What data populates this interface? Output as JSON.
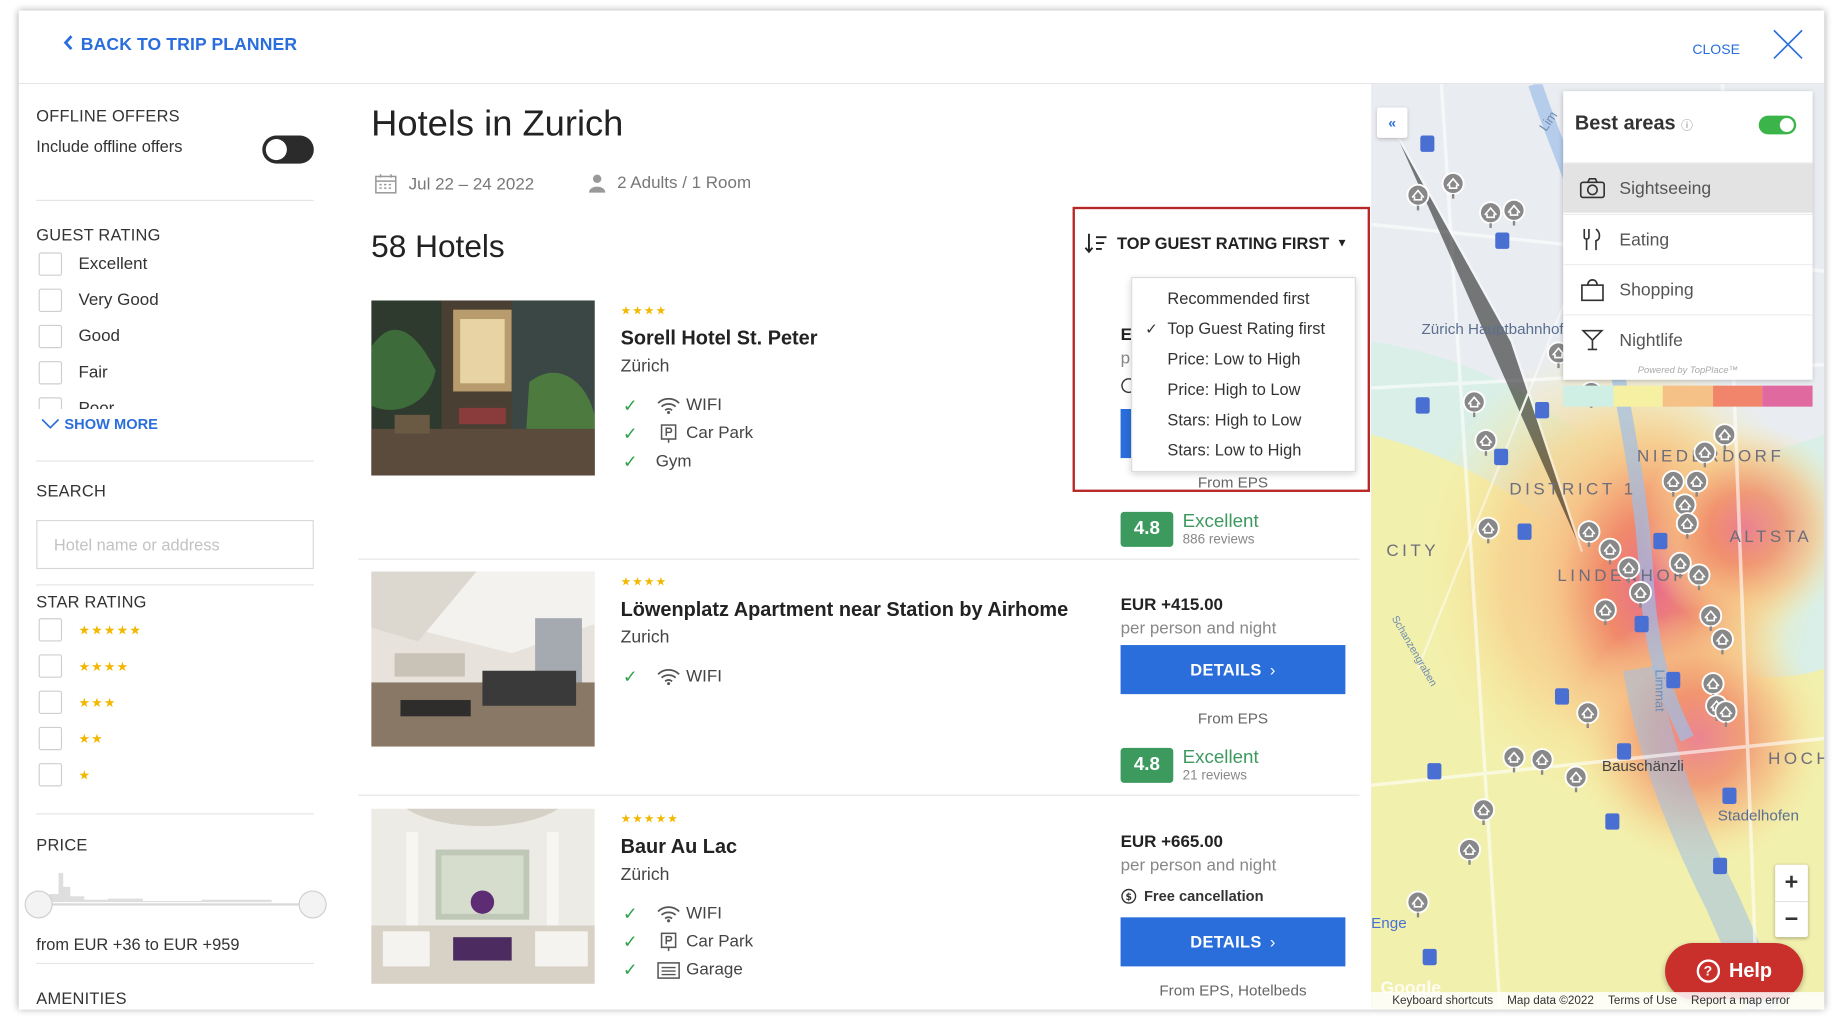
{
  "header": {
    "back_label": "BACK TO TRIP PLANNER",
    "close_label": "CLOSE"
  },
  "sidebar": {
    "offline": {
      "title": "OFFLINE OFFERS",
      "toggle_label": "Include offline offers",
      "enabled": false
    },
    "guest_rating": {
      "title": "GUEST RATING",
      "options": [
        "Excellent",
        "Very Good",
        "Good",
        "Fair",
        "Poor"
      ],
      "show_more": "SHOW MORE"
    },
    "search": {
      "title": "SEARCH",
      "placeholder": "Hotel name or address"
    },
    "star_rating": {
      "title": "STAR RATING",
      "options": [
        "★★★★★",
        "★★★★",
        "★★★",
        "★★",
        "★"
      ]
    },
    "price": {
      "title": "PRICE",
      "range_text": "from EUR +36 to EUR +959"
    },
    "amenities": {
      "title": "AMENITIES"
    }
  },
  "main": {
    "title": "Hotels in Zurich",
    "dates": "Jul 22 – 24 2022",
    "guests": "2 Adults / 1 Room",
    "count": "58 Hotels",
    "sort": {
      "label": "TOP GUEST RATING FIRST",
      "options": [
        "Recommended first",
        "Top Guest Rating first",
        "Price: Low to High",
        "Price: High to Low",
        "Stars: High to Low",
        "Stars: Low to High"
      ],
      "selected": "Top Guest Rating first"
    },
    "hotels": [
      {
        "stars": "★★★★",
        "name": "Sorell Hotel St. Peter",
        "city": "Zürich",
        "amenities": [
          "WIFI",
          "Car Park",
          "Gym"
        ],
        "price_partial": "E",
        "price_per_partial": "p",
        "source": "From EPS",
        "rating": "4.8",
        "rating_word": "Excellent",
        "reviews": "886 reviews"
      },
      {
        "stars": "★★★★",
        "name": "Löwenplatz Apartment near Station by Airhome",
        "city": "Zurich",
        "amenities": [
          "WIFI"
        ],
        "price": "EUR +415.00",
        "price_per": "per person and night",
        "details_label": "DETAILS",
        "source": "From EPS",
        "rating": "4.8",
        "rating_word": "Excellent",
        "reviews": "21 reviews"
      },
      {
        "stars": "★★★★★",
        "name": "Baur Au Lac",
        "city": "Zürich",
        "amenities": [
          "WIFI",
          "Car Park",
          "Garage"
        ],
        "price": "EUR +665.00",
        "price_per": "per person and night",
        "cancellation": "Free cancellation",
        "details_label": "DETAILS",
        "source": "From EPS, Hotelbeds"
      }
    ]
  },
  "map": {
    "collapse_label": "«",
    "best_areas": {
      "title": "Best areas",
      "info_icon": "info-icon",
      "enabled": true,
      "items": [
        "Sightseeing",
        "Eating",
        "Shopping",
        "Nightlife"
      ],
      "selected": "Sightseeing",
      "powered_by": "Powered by TopPlace™",
      "legend_colors": [
        "#cfeee4",
        "#f6f0a2",
        "#f6c187",
        "#f0856c",
        "#e06aa0"
      ]
    },
    "labels": {
      "station": "Zürich Hauptbahnhof",
      "niederdorf": "NIEDERDORF",
      "district": "DISTRICT 1",
      "city": "CITY",
      "altstadt": "ALTSTA",
      "lindenhof": "LINDENHOF",
      "bauschanzli": "Bauschänzli",
      "hoch": "HOCH",
      "stadelhofen": "Stadelhofen",
      "enge": "Enge",
      "limmat": "Limmat",
      "schanzengraben": "Schanzengraben",
      "lim": "Lim"
    },
    "zoom_in": "+",
    "zoom_out": "−",
    "help_label": "Help",
    "google": "Google",
    "attribution": [
      "Keyboard shortcuts",
      "Map data ©2022",
      "Terms of Use",
      "Report a map error"
    ]
  }
}
